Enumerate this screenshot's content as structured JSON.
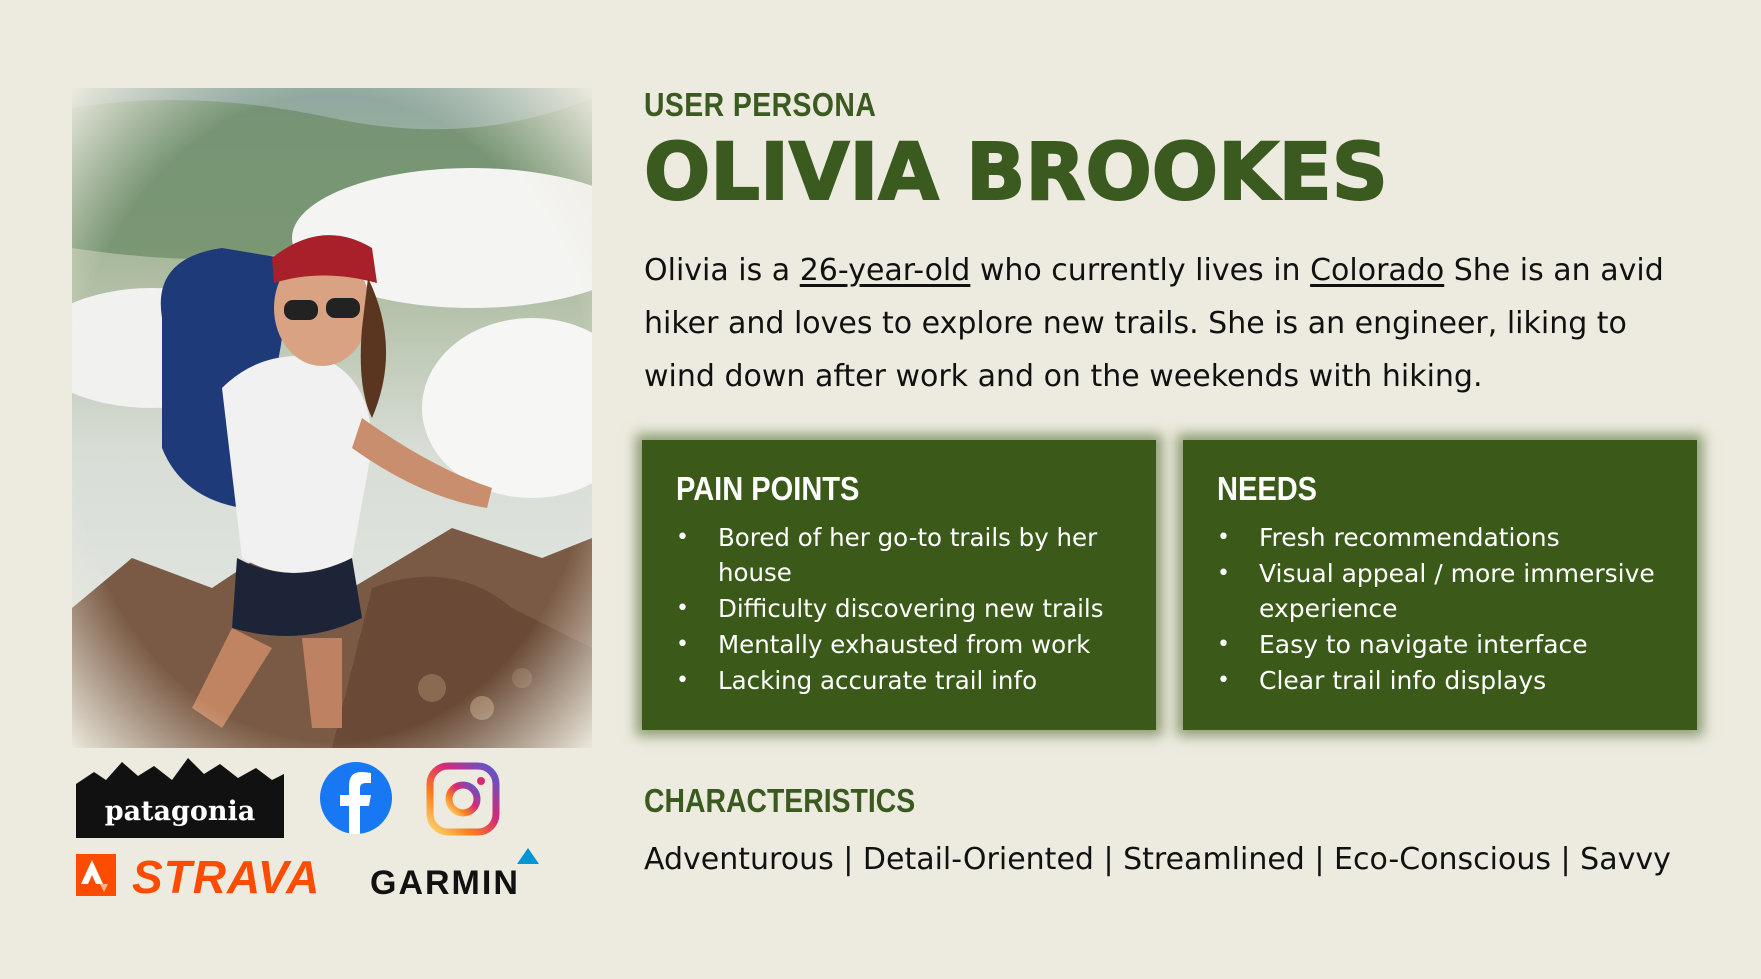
{
  "eyebrow": "USER PERSONA",
  "name": "OLIVIA BROOKES",
  "bio": {
    "part1": "Olivia is a ",
    "age": "26-year-old",
    "part2": " who currently lives in ",
    "location": "Colorado",
    "part3": " She is an avid hiker and loves to explore new trails. She is an engineer, liking to wind down after work and on the weekends with hiking."
  },
  "pain_points": {
    "title": "PAIN POINTS",
    "items": [
      "Bored of her go-to trails by her house",
      "Difficulty discovering new trails",
      "Mentally exhausted from work",
      "Lacking accurate trail info"
    ]
  },
  "needs": {
    "title": "NEEDS",
    "items": [
      "Fresh recommendations",
      "Visual appeal / more immersive experience",
      "Easy to navigate interface",
      "Clear trail info displays"
    ]
  },
  "characteristics": {
    "title": "CHARACTERISTICS",
    "text": "Adventurous | Detail-Oriented | Streamlined | Eco-Conscious | Savvy"
  },
  "brands": {
    "patagonia": "patagonia",
    "strava": "STRAVA",
    "garmin": "GARMIN",
    "facebook_icon": "facebook-icon",
    "instagram_icon": "instagram-icon"
  },
  "colors": {
    "background": "#EDEBDF",
    "accent_green": "#3A5A1F",
    "card_green": "#3B5A1A",
    "strava_orange": "#FC4C02",
    "facebook_blue": "#1877F2"
  },
  "photo_description_icon": "persona-photo"
}
